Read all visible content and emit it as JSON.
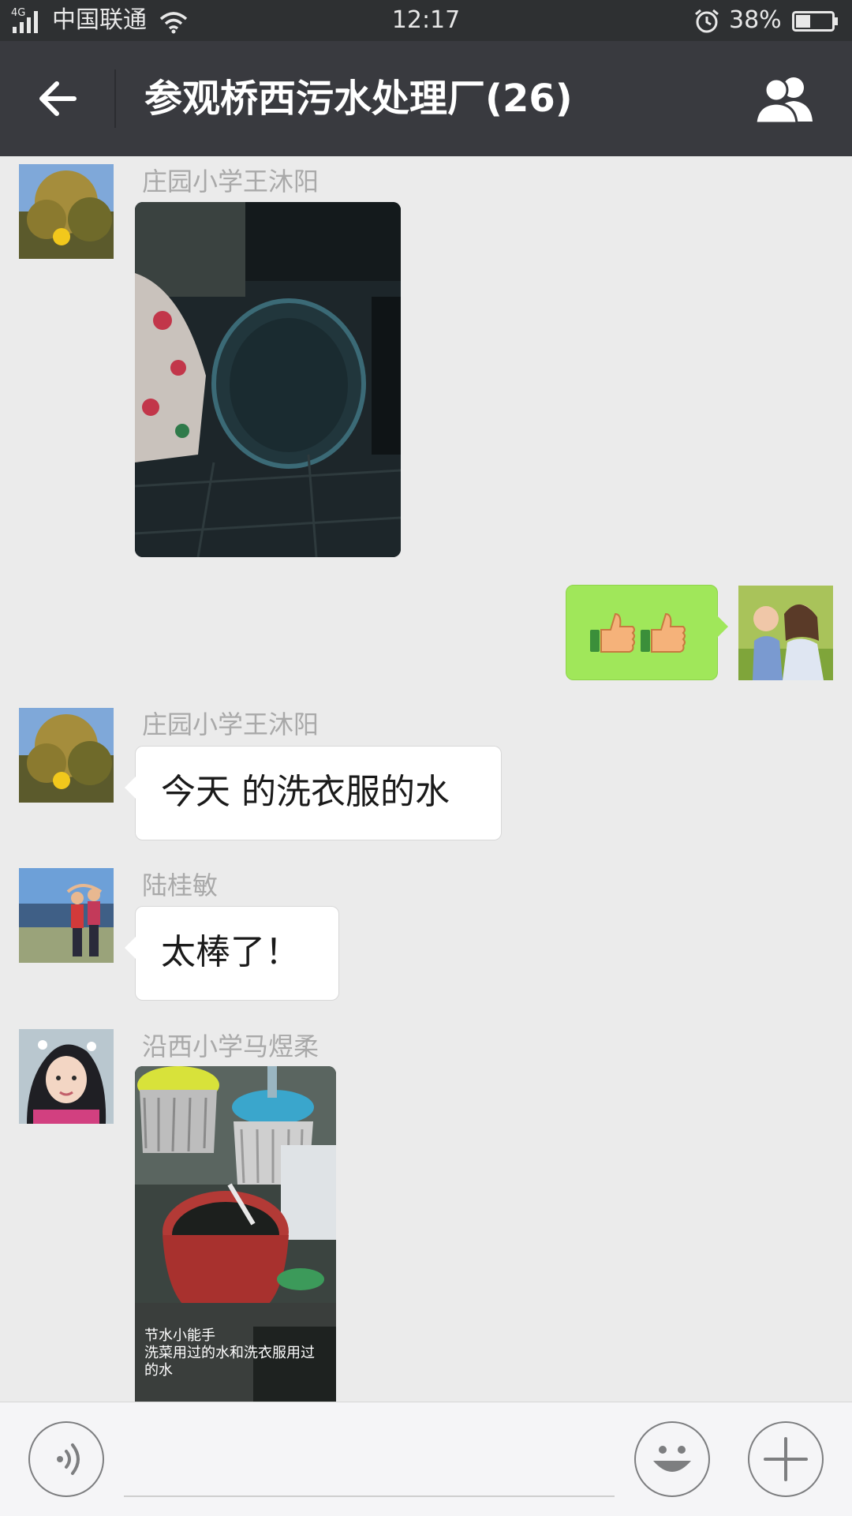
{
  "status_bar": {
    "network": "4G",
    "carrier": "中国联通",
    "time": "12:17",
    "battery": "38%"
  },
  "header": {
    "title": "参观桥西污水处理厂(26)",
    "back_icon": "arrow-left-icon",
    "members_icon": "group-members-icon"
  },
  "messages": [
    {
      "type": "image",
      "sender": "庄园小学王沐阳",
      "side": "left"
    },
    {
      "type": "emoji",
      "sender": "",
      "side": "right",
      "text": "👍👍"
    },
    {
      "type": "text",
      "sender": "庄园小学王沐阳",
      "side": "left",
      "text": "今天 的洗衣服的水"
    },
    {
      "type": "text",
      "sender": "陆桂敏",
      "side": "left",
      "text": "太棒了！"
    },
    {
      "type": "image",
      "sender": "沿西小学马煜柔",
      "side": "left",
      "caption": [
        "节水小能手",
        "洗菜用过的水和洗衣服用过",
        "的水"
      ]
    }
  ],
  "input_bar": {
    "voice_icon": "voice-icon",
    "emoji_icon": "emoji-icon",
    "plus_icon": "plus-icon"
  },
  "colors": {
    "status_bar": "#2e3032",
    "header": "#393a3f",
    "chat_background": "#ebebeb",
    "sent_bubble": "#a0e75a",
    "received_bubble": "#ffffff"
  }
}
